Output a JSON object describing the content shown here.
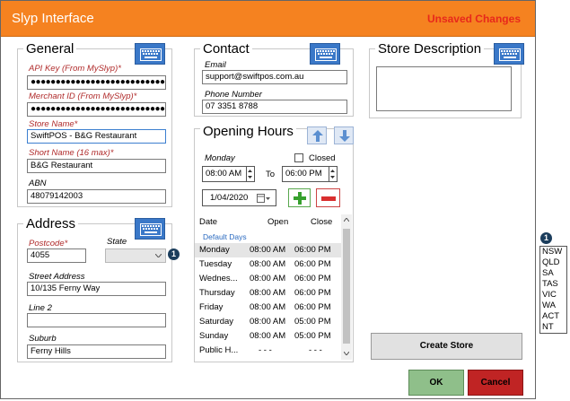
{
  "window": {
    "title": "Slyp Interface",
    "status": "Unsaved Changes"
  },
  "general": {
    "heading": "General",
    "keyboard_icon": "keyboard-icon",
    "api_key_label": "API Key (From MySlyp)*",
    "api_key_value": "●●●●●●●●●●●●●●●●●●●●●●●●●●●●●●●●●●●●●●●●●●●●●●●●",
    "merchant_id_label": "Merchant ID (From MySlyp)*",
    "merchant_id_value": "●●●●●●●●●●●●●●●●●●●●●●●●●●●●●●●●●●●●●●●●●●●●●●●●",
    "store_name_label": "Store Name*",
    "store_name_value": "SwiftPOS - B&G Restaurant",
    "short_name_label": "Short Name (16 max)*",
    "short_name_value": "B&G Restaurant",
    "abn_label": "ABN",
    "abn_value": "48079142003"
  },
  "address": {
    "heading": "Address",
    "postcode_label": "Postcode*",
    "postcode_value": "4055",
    "state_label": "State",
    "state_value": "",
    "street_label": "Street Address",
    "street_value": "10/135 Ferny Way",
    "line2_label": "Line 2",
    "line2_value": "",
    "suburb_label": "Suburb",
    "suburb_value": "Ferny Hills"
  },
  "contact": {
    "heading": "Contact",
    "email_label": "Email",
    "email_value": "support@swiftpos.com.au",
    "phone_label": "Phone Number",
    "phone_value": "07 3351 8788"
  },
  "opening_hours": {
    "heading": "Opening Hours",
    "day": "Monday",
    "closed_label": "Closed",
    "open_time": "08:00 AM",
    "to_label": "To",
    "close_time": "06:00 PM",
    "date": "1/04/2020",
    "columns": {
      "date": "Date",
      "open": "Open",
      "close": "Close"
    },
    "group_label": "Default Days",
    "rows": [
      {
        "day": "Monday",
        "open": "08:00 AM",
        "close": "06:00 PM"
      },
      {
        "day": "Tuesday",
        "open": "08:00 AM",
        "close": "06:00 PM"
      },
      {
        "day": "Wednes...",
        "open": "08:00 AM",
        "close": "06:00 PM"
      },
      {
        "day": "Thursday",
        "open": "08:00 AM",
        "close": "06:00 PM"
      },
      {
        "day": "Friday",
        "open": "08:00 AM",
        "close": "06:00 PM"
      },
      {
        "day": "Saturday",
        "open": "08:00 AM",
        "close": "05:00 PM"
      },
      {
        "day": "Sunday",
        "open": "08:00 AM",
        "close": "05:00 PM"
      },
      {
        "day": "Public H...",
        "open": "- - -",
        "close": "- - -"
      }
    ]
  },
  "store_description": {
    "heading": "Store Description",
    "value": ""
  },
  "buttons": {
    "create_store": "Create Store",
    "ok": "OK",
    "cancel": "Cancel"
  },
  "callout": {
    "number": "1",
    "state_options": [
      "NSW",
      "QLD",
      "SA",
      "TAS",
      "VIC",
      "WA",
      "ACT",
      "NT"
    ]
  },
  "colors": {
    "titlebar": "#f58220",
    "unsaved": "#e8281b",
    "ok": "#8fbf8a",
    "cancel": "#c02424",
    "keyboard": "#3a78c8"
  }
}
